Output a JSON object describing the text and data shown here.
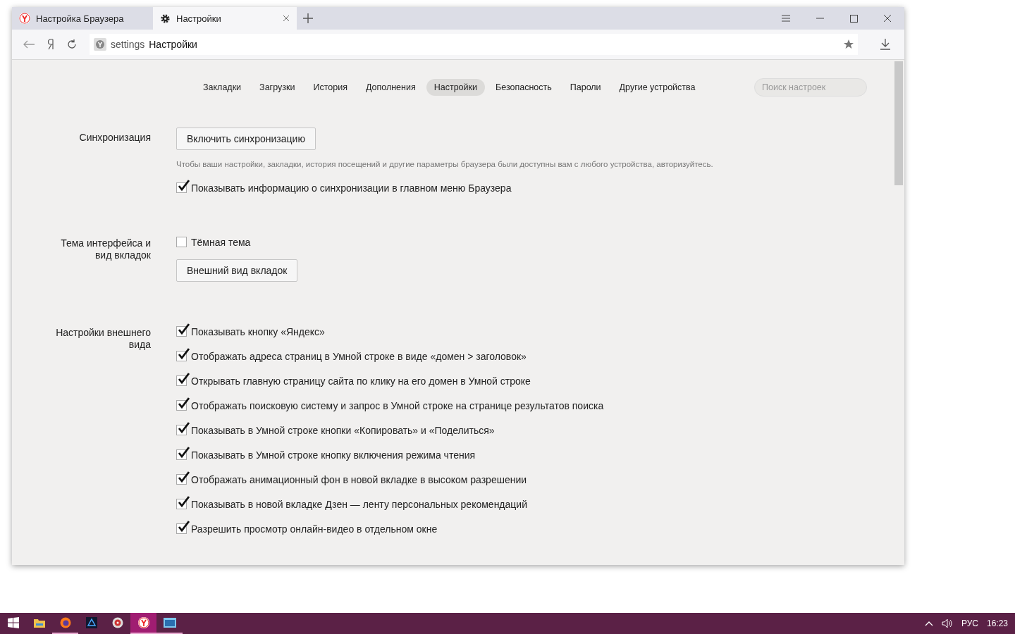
{
  "browser_tabs": [
    {
      "kind": "yandex",
      "title": "Настройка Браузера",
      "selected": false
    },
    {
      "kind": "settings",
      "title": "Настройки",
      "selected": true
    }
  ],
  "address_bar": {
    "scheme": "settings",
    "title": "Настройки"
  },
  "nav": [
    {
      "label": "Закладки",
      "selected": false
    },
    {
      "label": "Загрузки",
      "selected": false
    },
    {
      "label": "История",
      "selected": false
    },
    {
      "label": "Дополнения",
      "selected": false
    },
    {
      "label": "Настройки",
      "selected": true
    },
    {
      "label": "Безопасность",
      "selected": false
    },
    {
      "label": "Пароли",
      "selected": false
    },
    {
      "label": "Другие устройства",
      "selected": false
    }
  ],
  "search": {
    "placeholder": "Поиск настроек"
  },
  "sections": [
    {
      "label": "Синхронизация",
      "items": [
        {
          "kind": "button",
          "label": "Включить синхронизацию"
        },
        {
          "kind": "hint",
          "text": "Чтобы ваши настройки, закладки, история посещений и другие параметры браузера были доступны вам с любого устройства, авторизуйтесь."
        },
        {
          "kind": "checkbox",
          "label": "Показывать информацию о синхронизации в главном меню Браузера",
          "checked": true
        }
      ]
    },
    {
      "label": "Тема интерфейса и вид вкладок",
      "items": [
        {
          "kind": "checkbox",
          "label": "Тёмная тема",
          "checked": false
        },
        {
          "kind": "button",
          "label": "Внешний вид вкладок"
        }
      ]
    },
    {
      "label": "Настройки внешнего вида",
      "items": [
        {
          "kind": "checkbox",
          "label": "Показывать кнопку «Яндекс»",
          "checked": true
        },
        {
          "kind": "checkbox",
          "label": "Отображать адреса страниц в Умной строке в виде «домен > заголовок»",
          "checked": true
        },
        {
          "kind": "checkbox",
          "label": "Открывать главную страницу сайта по клику на его домен в Умной строке",
          "checked": true
        },
        {
          "kind": "checkbox",
          "label": "Отображать поисковую систему и запрос в Умной строке на странице результатов поиска",
          "checked": true
        },
        {
          "kind": "checkbox",
          "label": "Показывать в Умной строке кнопки «Копировать» и «Поделиться»",
          "checked": true
        },
        {
          "kind": "checkbox",
          "label": "Показывать в Умной строке кнопку включения режима чтения",
          "checked": true
        },
        {
          "kind": "checkbox",
          "label": "Отображать анимационный фон в новой вкладке в высоком разрешении",
          "checked": true
        },
        {
          "kind": "checkbox",
          "label": "Показывать в новой вкладке Дзен — ленту персональных рекомендаций",
          "checked": true
        },
        {
          "kind": "checkbox",
          "label": "Разрешить просмотр онлайн-видео в отдельном окне",
          "checked": true
        }
      ]
    }
  ],
  "taskbar": {
    "apps": [
      {
        "kind": "folder",
        "running": false,
        "selected": false
      },
      {
        "kind": "firefox",
        "running": true,
        "selected": false
      },
      {
        "kind": "editor",
        "running": false,
        "selected": false
      },
      {
        "kind": "disc",
        "running": false,
        "selected": false
      },
      {
        "kind": "yandex",
        "running": true,
        "selected": true
      },
      {
        "kind": "window",
        "running": true,
        "selected": false
      }
    ],
    "language": "РУС",
    "time": "16:23"
  }
}
